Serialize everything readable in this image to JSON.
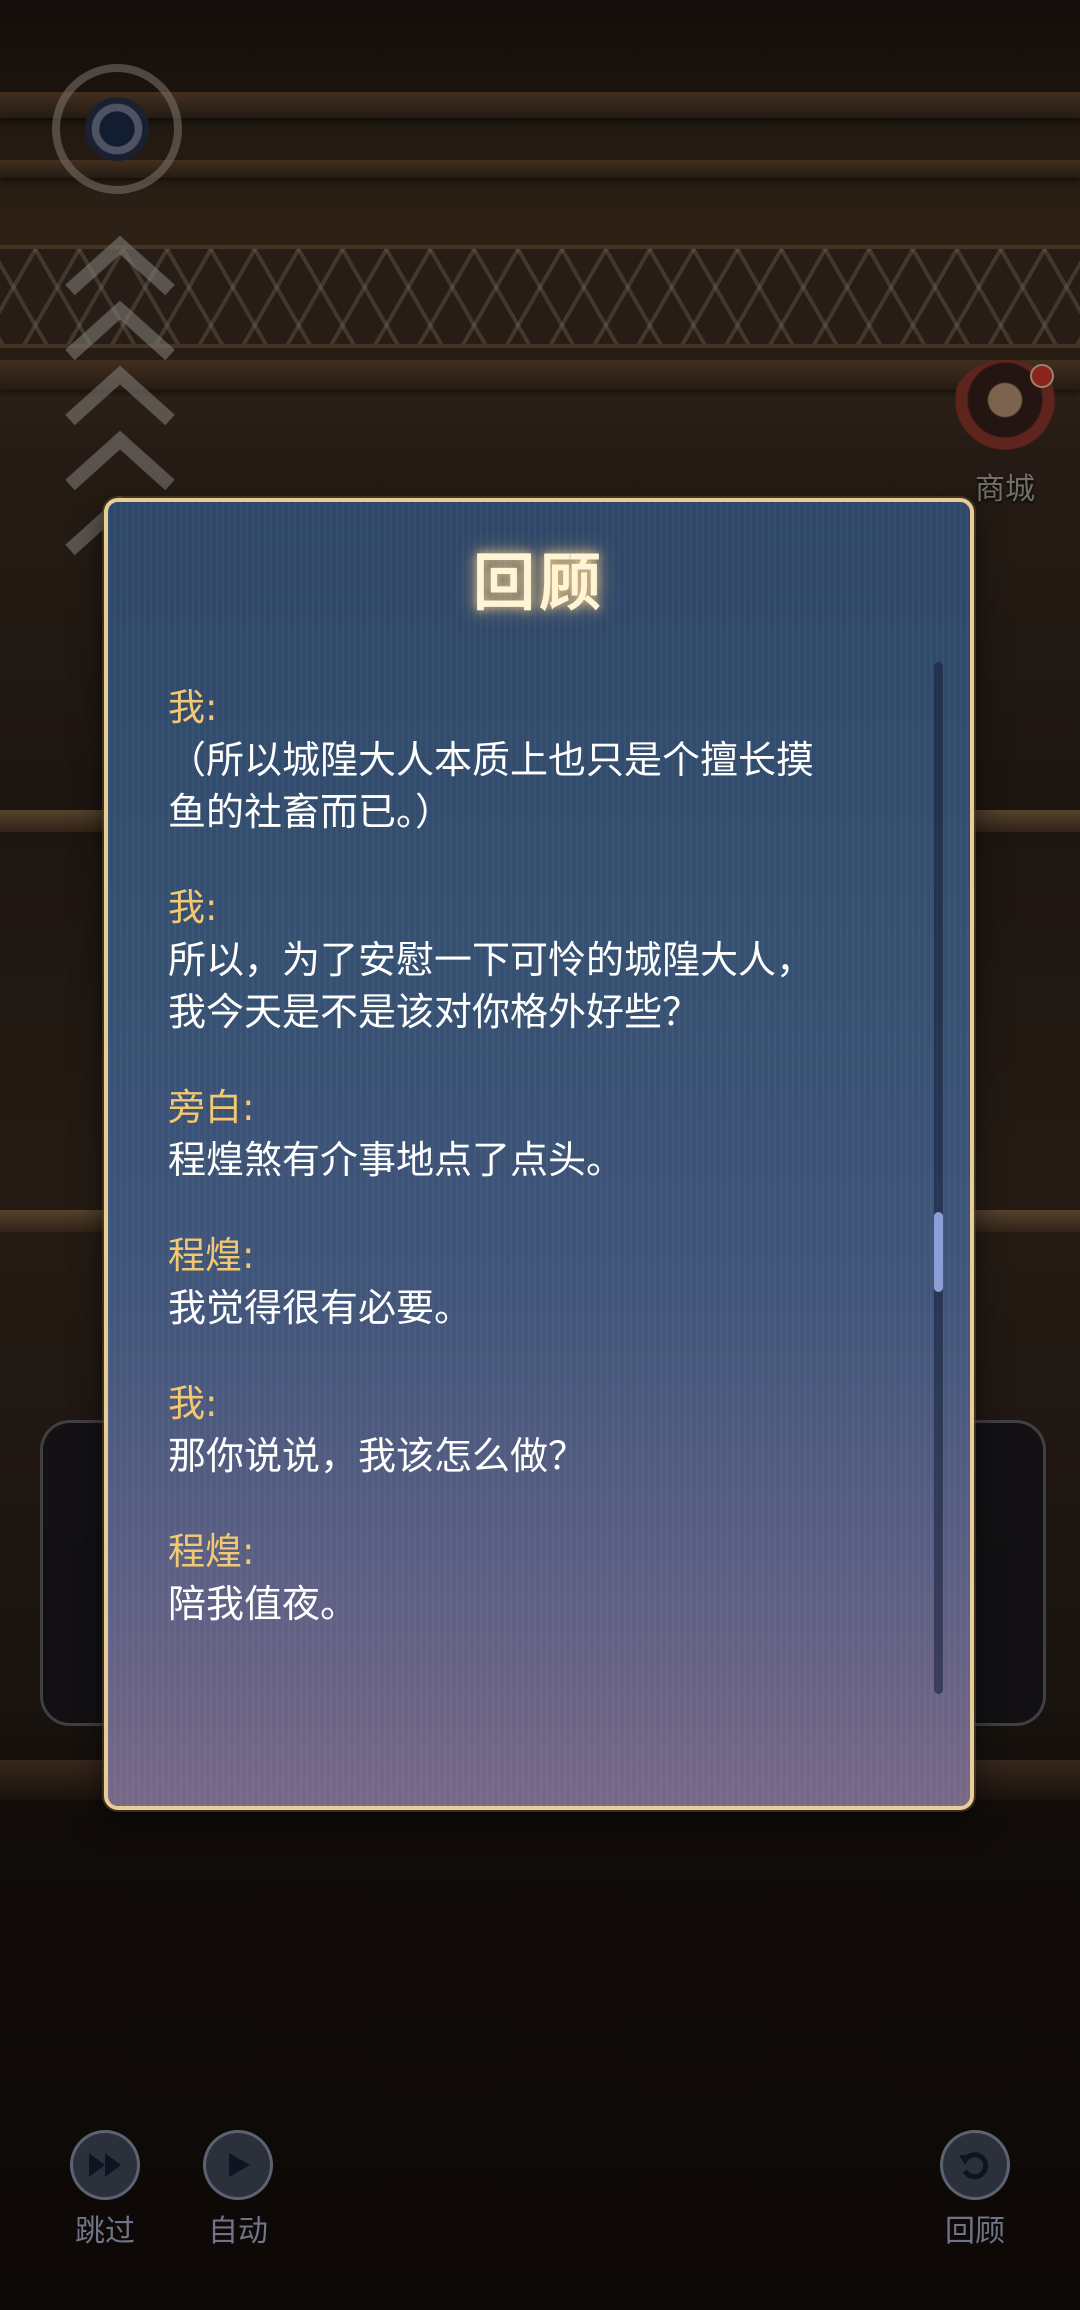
{
  "dialog": {
    "title": "回顾",
    "entries": [
      {
        "speaker": "我:",
        "text": "（所以城隍大人本质上也只是个擅长摸\n鱼的社畜而已。）"
      },
      {
        "speaker": "我:",
        "text": "所以，为了安慰一下可怜的城隍大人，\n我今天是不是该对你格外好些？"
      },
      {
        "speaker": "旁白:",
        "text": "程煌煞有介事地点了点头。"
      },
      {
        "speaker": "程煌:",
        "text": "我觉得很有必要。"
      },
      {
        "speaker": "我:",
        "text": "那你说说，我该怎么做？"
      },
      {
        "speaker": "程煌:",
        "text": "陪我值夜。"
      }
    ]
  },
  "shop": {
    "label": "商城"
  },
  "controls": {
    "skip_label": "跳过",
    "auto_label": "自动",
    "review_label": "回顾"
  },
  "colors": {
    "speaker": "#f2c872",
    "dialog_border": "#e7cd97",
    "title_glow": "#ffd68c"
  },
  "icons": {
    "skip": "fast-forward-icon",
    "auto": "play-icon",
    "review": "review-icon",
    "shop": "shop-icon"
  }
}
